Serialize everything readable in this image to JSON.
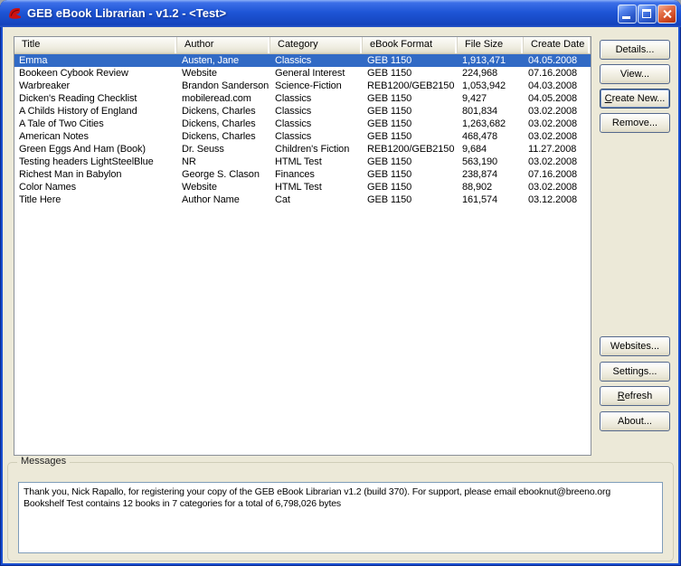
{
  "window": {
    "title": "GEB eBook Librarian - v1.2 - <Test>",
    "titlebar_controls": [
      "minimize",
      "maximize",
      "close"
    ]
  },
  "colors": {
    "titlebar_blue": "#1E55D6",
    "selection_blue": "#316AC5",
    "window_bg": "#ECE9D8",
    "close_red": "#D04A22"
  },
  "table": {
    "columns": [
      "Title",
      "Author",
      "Category",
      "eBook Format",
      "File Size",
      "Create Date"
    ],
    "selected_index": 0,
    "rows": [
      [
        "Emma",
        "Austen, Jane",
        "Classics",
        "GEB 1150",
        "1,913,471",
        "04.05.2008"
      ],
      [
        "Bookeen Cybook Review",
        "Website",
        "General Interest",
        "GEB 1150",
        "224,968",
        "07.16.2008"
      ],
      [
        "Warbreaker",
        "Brandon Sanderson",
        "Science-Fiction",
        "REB1200/GEB2150",
        "1,053,942",
        "04.03.2008"
      ],
      [
        "Dicken's Reading Checklist",
        "mobileread.com",
        "Classics",
        "GEB 1150",
        "9,427",
        "04.05.2008"
      ],
      [
        "A Childs History of England",
        "Dickens, Charles",
        "Classics",
        "GEB 1150",
        "801,834",
        "03.02.2008"
      ],
      [
        "A Tale of Two Cities",
        "Dickens, Charles",
        "Classics",
        "GEB 1150",
        "1,263,682",
        "03.02.2008"
      ],
      [
        "American Notes",
        "Dickens, Charles",
        "Classics",
        "GEB 1150",
        "468,478",
        "03.02.2008"
      ],
      [
        "Green Eggs And Ham (Book)",
        "Dr. Seuss",
        "Children's Fiction",
        "REB1200/GEB2150",
        "9,684",
        "11.27.2008"
      ],
      [
        "Testing headers LightSteelBlue",
        "NR",
        "HTML Test",
        "GEB 1150",
        "563,190",
        "03.02.2008"
      ],
      [
        "Richest Man in Babylon",
        "George S. Clason",
        "Finances",
        "GEB 1150",
        "238,874",
        "07.16.2008"
      ],
      [
        "Color Names",
        "Website",
        "HTML Test",
        "GEB 1150",
        "88,902",
        "03.02.2008"
      ],
      [
        "Title Here",
        "Author Name",
        "Cat",
        "GEB 1150",
        "161,574",
        "03.12.2008"
      ]
    ]
  },
  "buttons": [
    {
      "label": "Details...",
      "name": "details-button"
    },
    {
      "label": "View...",
      "name": "view-button"
    },
    {
      "label": "Create New...",
      "name": "create-new-button",
      "default": true,
      "accel": 0
    },
    {
      "label": "Remove...",
      "name": "remove-button"
    },
    {
      "label": "Websites...",
      "name": "websites-button"
    },
    {
      "label": "Settings...",
      "name": "settings-button"
    },
    {
      "label": "Refresh",
      "name": "refresh-button",
      "accel": 0
    },
    {
      "label": "About...",
      "name": "about-button"
    }
  ],
  "messages": {
    "label": "Messages",
    "lines": [
      "Thank you, Nick Rapallo, for registering your copy of the GEB eBook Librarian v1.2 (build 370). For support, please email ebooknut@breeno.org",
      "Bookshelf Test contains 12 books in 7 categories for a total of 6,798,026 bytes"
    ]
  }
}
